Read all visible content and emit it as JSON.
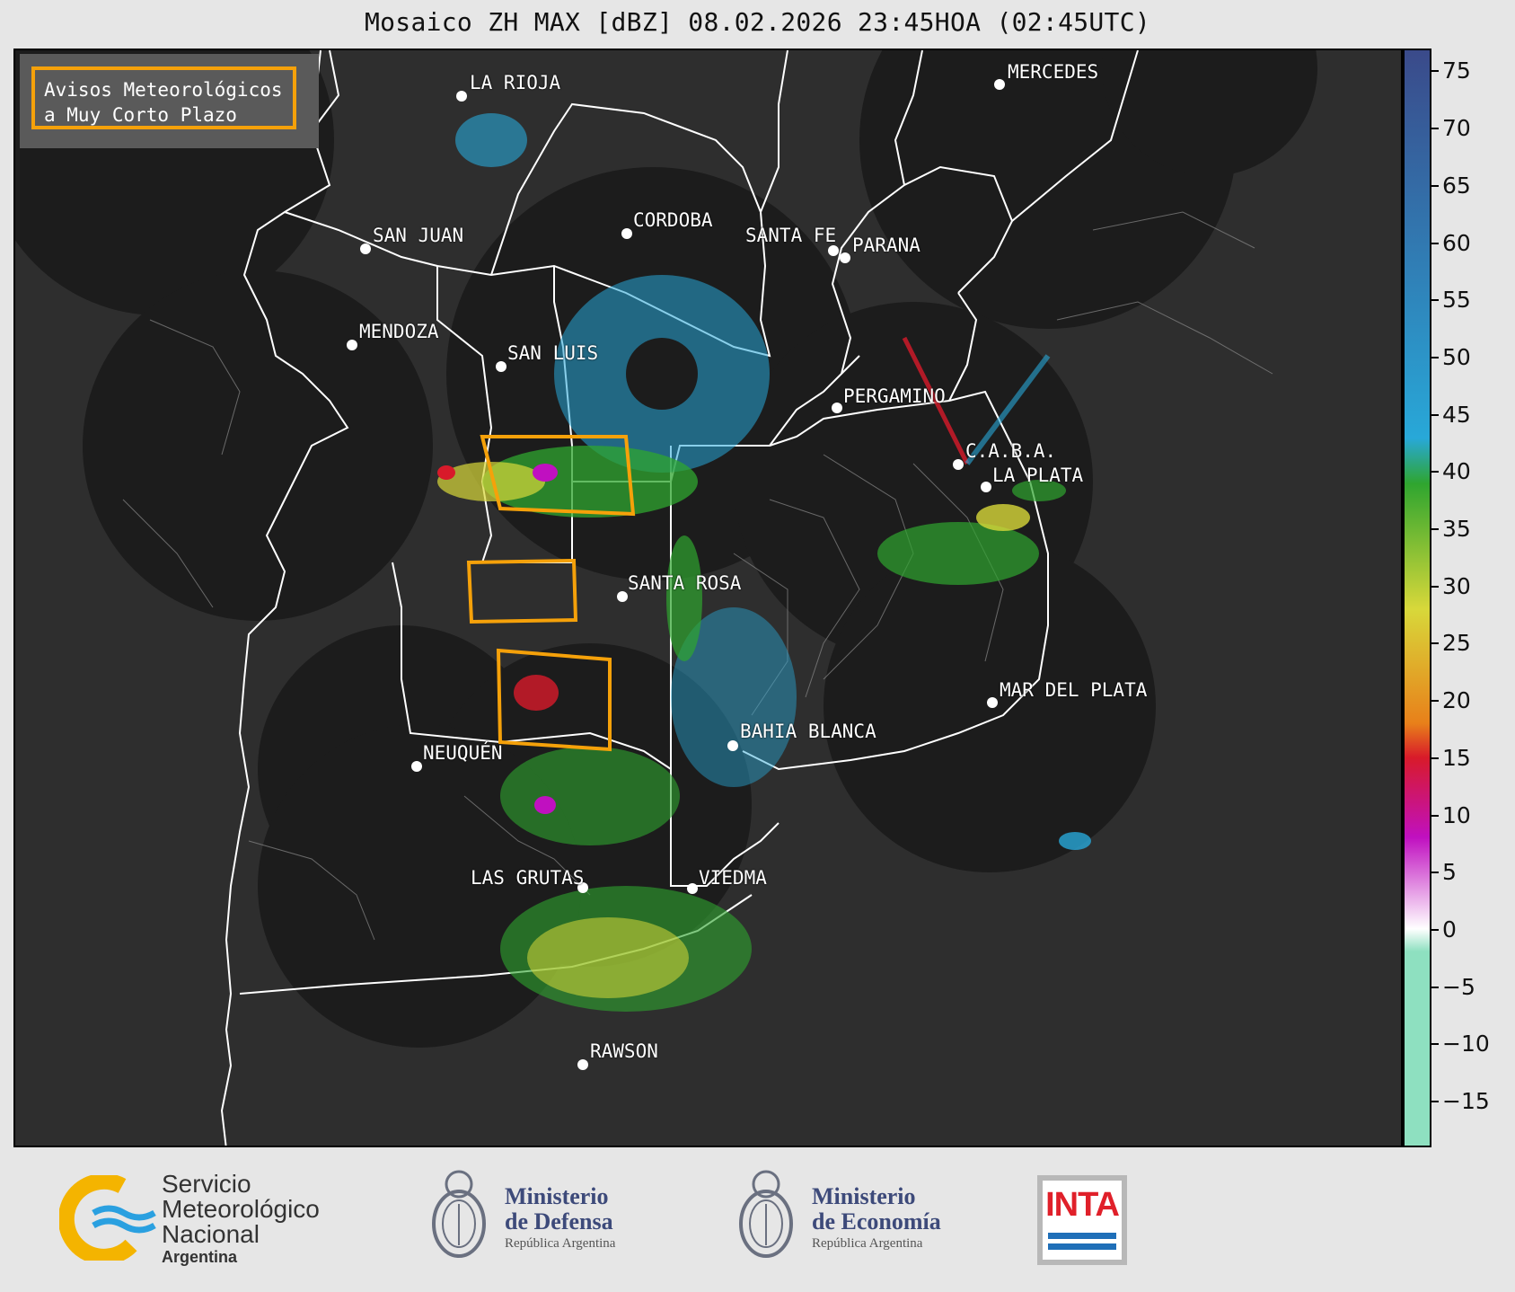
{
  "title": "Mosaico ZH MAX [dBZ] 08.02.2026 23:45HOA (02:45UTC)",
  "legend": {
    "line1": "Avisos Meteorológicos",
    "line2": "a Muy Corto Plazo",
    "color": "#f5a10a"
  },
  "cities": [
    {
      "name": "LA RIOJA",
      "label": "LA RIOJA"
    },
    {
      "name": "MERCEDES",
      "label": "MERCEDES"
    },
    {
      "name": "CORDOBA",
      "label": "CORDOBA"
    },
    {
      "name": "SAN JUAN",
      "label": "SAN JUAN"
    },
    {
      "name": "SANTA FE",
      "label": "SANTA FE"
    },
    {
      "name": "PARANA",
      "label": "PARANA"
    },
    {
      "name": "MENDOZA",
      "label": "MENDOZA"
    },
    {
      "name": "SAN LUIS",
      "label": "SAN LUIS"
    },
    {
      "name": "PERGAMINO",
      "label": "PERGAMINO"
    },
    {
      "name": "CABA",
      "label": "C.A.B.A."
    },
    {
      "name": "LA PLATA",
      "label": "LA PLATA"
    },
    {
      "name": "SANTA ROSA",
      "label": "SANTA ROSA"
    },
    {
      "name": "MAR DEL PLATA",
      "label": "MAR DEL PLATA"
    },
    {
      "name": "BAHIA BLANCA",
      "label": "BAHIA BLANCA"
    },
    {
      "name": "NEUQUEN",
      "label": "NEUQUÉN"
    },
    {
      "name": "LAS GRUTAS",
      "label": "LAS GRUTAS"
    },
    {
      "name": "VIEDMA",
      "label": "VIEDMA"
    },
    {
      "name": "RAWSON",
      "label": "RAWSON"
    }
  ],
  "colorbar": {
    "unit": "dBZ",
    "ticks": [
      "75",
      "70",
      "65",
      "60",
      "55",
      "50",
      "45",
      "40",
      "35",
      "30",
      "25",
      "20",
      "15",
      "10",
      "5",
      "0",
      "−5",
      "−10",
      "−15"
    ],
    "tick_values": [
      75,
      70,
      65,
      60,
      55,
      50,
      45,
      40,
      35,
      30,
      25,
      20,
      15,
      10,
      5,
      0,
      -5,
      -10,
      -15
    ],
    "range": [
      -19,
      77
    ],
    "bands": [
      {
        "from": -19,
        "to": 15,
        "color": "#3a4a8a"
      },
      {
        "from": 15,
        "to": 19,
        "color": "#28a8d8"
      },
      {
        "from": 19,
        "to": 30,
        "color": "#2fa52f"
      },
      {
        "from": 30,
        "to": 40,
        "color": "#d8d83a"
      },
      {
        "from": 40,
        "to": 43,
        "color": "#e8801a"
      },
      {
        "from": 43,
        "to": 50,
        "color": "#d81a2a"
      },
      {
        "from": 50,
        "to": 58,
        "color": "#c010c0"
      },
      {
        "from": 58,
        "to": 60,
        "color": "#ffffff"
      },
      {
        "from": 60,
        "to": 77,
        "color": "#8ee0c0"
      }
    ]
  },
  "footer": {
    "smn": {
      "line1": "Servicio",
      "line2": "Meteorológico",
      "line3": "Nacional",
      "line4": "Argentina"
    },
    "defensa": {
      "line1": "Ministerio",
      "line2": "de Defensa",
      "line3": "República Argentina"
    },
    "economia": {
      "line1": "Ministerio",
      "line2": "de Economía",
      "line3": "República Argentina"
    },
    "inta": {
      "label": "INTA"
    }
  },
  "colors": {
    "map_bg": "#2e2e2e",
    "radar_disk": "#1c1c1c",
    "border": "#ffffff",
    "warning": "#f5a10a"
  }
}
